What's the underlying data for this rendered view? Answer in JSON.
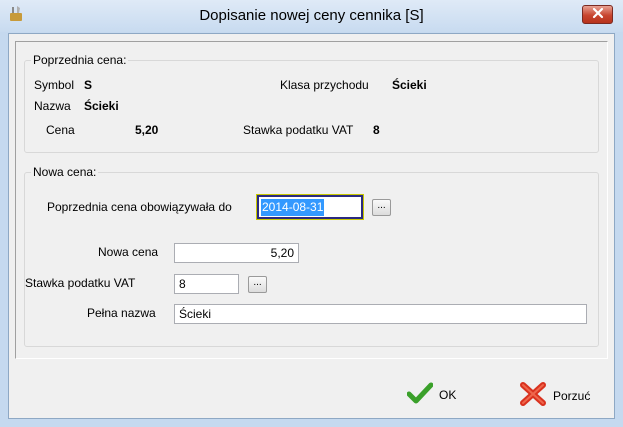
{
  "window": {
    "title": "Dopisanie nowej ceny cennika [S]"
  },
  "previous": {
    "group_title": "Poprzednia cena:",
    "symbol_label": "Symbol",
    "symbol_value": "S",
    "name_label": "Nazwa",
    "name_value": "Ścieki",
    "price_label": "Cena",
    "price_value": "5,20",
    "income_class_label": "Klasa przychodu",
    "income_class_value": "Ścieki",
    "vat_label": "Stawka podatku VAT",
    "vat_value": "8"
  },
  "new": {
    "group_title": "Nowa cena:",
    "valid_until_label": "Poprzednia cena obowiązywała do",
    "valid_until_value": "2014-08-31",
    "price_label": "Nowa cena",
    "price_value": "5,20",
    "vat_label": "Stawka podatku VAT",
    "vat_value": "8",
    "full_name_label": "Pełna nazwa",
    "full_name_value": "Ścieki",
    "browse_label": "..."
  },
  "buttons": {
    "ok_label": "OK",
    "cancel_label": "Porzuć"
  },
  "icons": {
    "app": "wrench-icon",
    "close": "close-icon",
    "ok": "checkmark-icon",
    "cancel": "x-icon"
  },
  "colors": {
    "selection": "#3399ff",
    "ok_green": "#3aa02a",
    "cancel_red": "#d9321f"
  }
}
